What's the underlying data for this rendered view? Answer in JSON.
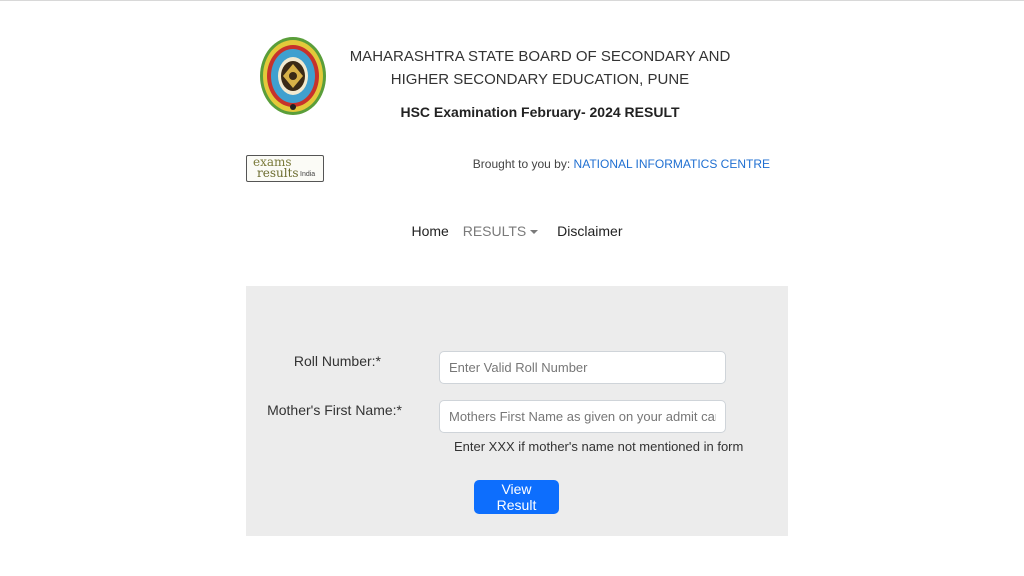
{
  "header": {
    "board_line1": "MAHARASHTRA STATE BOARD OF SECONDARY AND",
    "board_line2": "HIGHER SECONDARY EDUCATION, PUNE",
    "exam_title": "HSC Examination February- 2024 RESULT",
    "logo_icon": "board-emblem-icon"
  },
  "partner": {
    "logo_line1": "exams",
    "logo_line2": "results",
    "logo_line3": "India",
    "brought_label": "Brought to you by:",
    "brought_org": "NATIONAL INFORMATICS CENTRE"
  },
  "nav": {
    "home": "Home",
    "results": "RESULTS",
    "disclaimer": "Disclaimer"
  },
  "form": {
    "roll_label": "Roll Number:*",
    "roll_placeholder": "Enter Valid Roll Number",
    "mother_label": "Mother's First Name:*",
    "mother_placeholder": "Mothers First Name as given on your admit card/form",
    "mother_hint": "Enter XXX if mother's name not mentioned in form",
    "submit_label": "View Result"
  },
  "colors": {
    "panel_bg": "#ececec",
    "button_bg": "#0d6efd",
    "link": "#1f6fd1"
  }
}
